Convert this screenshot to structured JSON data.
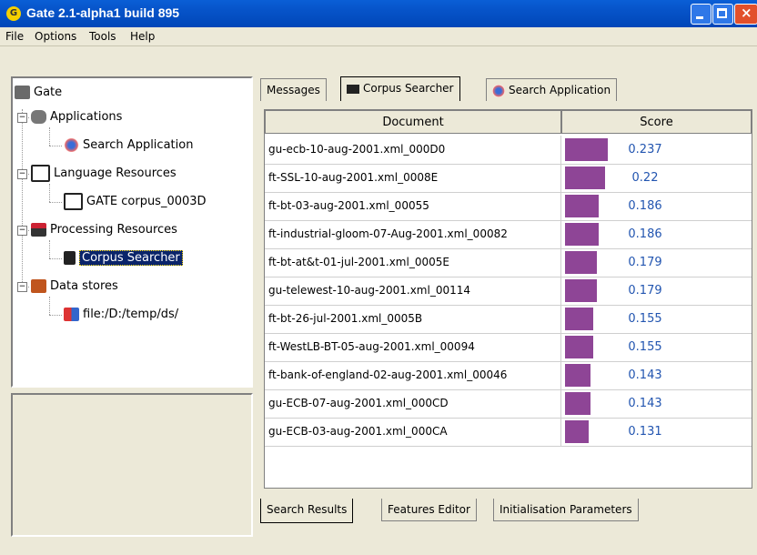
{
  "window": {
    "title": "Gate 2.1-alpha1 build 895",
    "app_icon_glyph": "G",
    "close_glyph": "×"
  },
  "menubar": {
    "items": [
      "File",
      "Options",
      "Tools",
      "Help"
    ]
  },
  "tree": {
    "root": "Gate",
    "nodes": [
      {
        "label": "Applications",
        "icon": "applications-icon",
        "expanded": true
      },
      {
        "label": "Search Application",
        "icon": "atom-icon"
      },
      {
        "label": "Language Resources",
        "icon": "documents-icon",
        "expanded": true
      },
      {
        "label": "GATE corpus_0003D",
        "icon": "documents-icon"
      },
      {
        "label": "Processing Resources",
        "icon": "processor-icon",
        "expanded": true
      },
      {
        "label": "Corpus Searcher",
        "icon": "binoculars-icon",
        "selected": true
      },
      {
        "label": "Data stores",
        "icon": "datastore-icon",
        "expanded": true
      },
      {
        "label": "file:/D:/temp/ds/",
        "icon": "database-icon"
      }
    ],
    "expander_glyph": "−"
  },
  "top_tabs": [
    {
      "label": "Messages",
      "active": false
    },
    {
      "label": "Corpus Searcher",
      "active": true,
      "icon": "binoculars-icon"
    },
    {
      "label": "Search Application",
      "active": false,
      "icon": "atom-icon"
    }
  ],
  "table": {
    "columns": [
      "Document",
      "Score"
    ],
    "rows": [
      {
        "document": "gu-ecb-10-aug-2001.xml_000D0",
        "score": "0.237",
        "value": 0.237
      },
      {
        "document": "ft-SSL-10-aug-2001.xml_0008E",
        "score": "0.22",
        "value": 0.22
      },
      {
        "document": "ft-bt-03-aug-2001.xml_00055",
        "score": "0.186",
        "value": 0.186
      },
      {
        "document": "ft-industrial-gloom-07-Aug-2001.xml_00082",
        "score": "0.186",
        "value": 0.186
      },
      {
        "document": "ft-bt-at&t-01-jul-2001.xml_0005E",
        "score": "0.179",
        "value": 0.179
      },
      {
        "document": "gu-telewest-10-aug-2001.xml_00114",
        "score": "0.179",
        "value": 0.179
      },
      {
        "document": "ft-bt-26-jul-2001.xml_0005B",
        "score": "0.155",
        "value": 0.155
      },
      {
        "document": "ft-WestLB-BT-05-aug-2001.xml_00094",
        "score": "0.155",
        "value": 0.155
      },
      {
        "document": "ft-bank-of-england-02-aug-2001.xml_00046",
        "score": "0.143",
        "value": 0.143
      },
      {
        "document": "gu-ECB-07-aug-2001.xml_000CD",
        "score": "0.143",
        "value": 0.143
      },
      {
        "document": "gu-ECB-03-aug-2001.xml_000CA",
        "score": "0.131",
        "value": 0.131
      }
    ],
    "bar_color": "#8E4596",
    "score_color": "#2255B0"
  },
  "bottom_tabs": [
    {
      "label": "Search Results",
      "active": true
    },
    {
      "label": "Features Editor",
      "active": false
    },
    {
      "label": "Initialisation Parameters",
      "active": false
    }
  ]
}
